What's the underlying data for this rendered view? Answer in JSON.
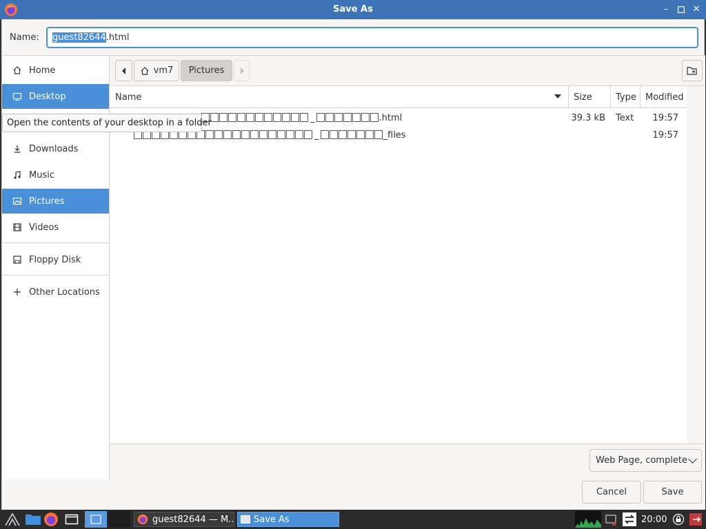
{
  "window": {
    "title": "Save As"
  },
  "name_field": {
    "label": "Name:",
    "selected_part": "guest82644",
    "rest": ".html"
  },
  "sidebar": {
    "items": [
      {
        "label": "Home",
        "icon": "home-icon"
      },
      {
        "label": "Desktop",
        "icon": "desktop-icon"
      },
      {
        "label": "Downloads",
        "icon": "download-icon"
      },
      {
        "label": "Music",
        "icon": "music-icon"
      },
      {
        "label": "Pictures",
        "icon": "picture-icon"
      },
      {
        "label": "Videos",
        "icon": "video-icon"
      },
      {
        "label": "Floppy Disk",
        "icon": "floppy-icon"
      },
      {
        "label": "Other Locations",
        "icon": "plus-icon"
      }
    ],
    "active": [
      "Desktop",
      "Pictures"
    ]
  },
  "tooltip": "Open the contents of your desktop in a folder",
  "pathbar": {
    "segments": [
      "vm7",
      "Pictures"
    ]
  },
  "columns": {
    "name": "Name",
    "size": "Size",
    "type": "Type",
    "modified": "Modified"
  },
  "files": [
    {
      "name_suffix": ".html",
      "size": "39.3 kB",
      "type": "Text",
      "modified": "19:57"
    },
    {
      "name_suffix": "_files",
      "size": "",
      "type": "",
      "modified": "19:57"
    }
  ],
  "filter": {
    "selected": "Web Page, complete"
  },
  "buttons": {
    "cancel": "Cancel",
    "save": "Save"
  },
  "taskbar": {
    "tasks": [
      {
        "label": "guest82644 — M...",
        "icon": "firefox-icon"
      },
      {
        "label": "Save As",
        "icon": "window-icon"
      }
    ],
    "clock": "20:00"
  },
  "colors": {
    "accent": "#4a90d9",
    "titlebar": "#3d74b8",
    "taskbar": "#2b2b2b"
  }
}
